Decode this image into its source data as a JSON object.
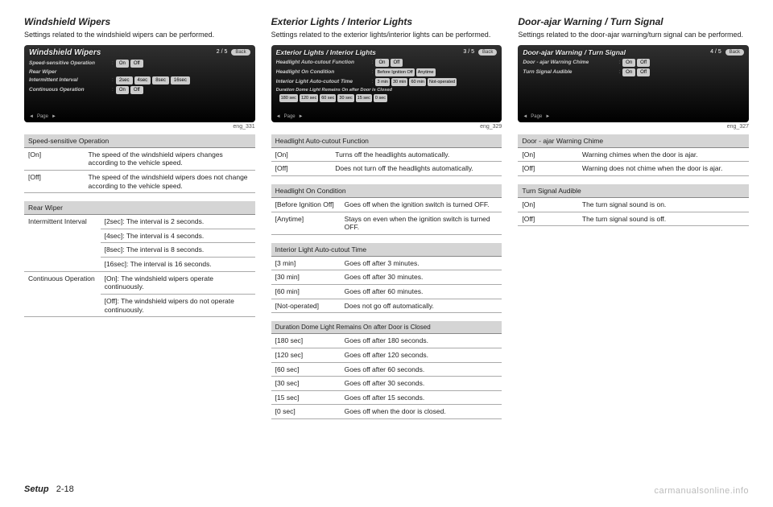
{
  "footer": {
    "label": "Setup",
    "page": "2-18"
  },
  "watermark": "carmanualsonline.info",
  "col1": {
    "heading": "Windshield Wipers",
    "intro": "Settings related to the windshield wipers can be performed.",
    "eng": "eng_331",
    "panel": {
      "title": "Windshield Wipers",
      "page": "2 / 5",
      "back": "Back",
      "rows": {
        "r1_label": "Speed-sensitive Operation",
        "r1_opts": [
          "On",
          "Off"
        ],
        "r2_label": "Rear Wiper",
        "r3_label": "Intermittent Interval",
        "r3_opts": [
          "2sec",
          "4sec",
          "8sec",
          "16sec"
        ],
        "r4_label": "Continuous Operation",
        "r4_opts": [
          "On",
          "Off"
        ]
      },
      "footer": {
        "prev": "◄",
        "label": "Page",
        "next": "►"
      }
    },
    "table1": {
      "header": "Speed-sensitive Operation",
      "rows": [
        {
          "k": "[On]",
          "v": "The speed of the windshield wipers changes according to the vehicle speed."
        },
        {
          "k": "[Off]",
          "v": "The speed of the windshield wipers does not change according to the vehicle speed."
        }
      ]
    },
    "table2": {
      "header": "Rear Wiper",
      "rows": [
        {
          "k": "Intermittent Interval",
          "v": "[2sec]: The interval is 2 seconds."
        },
        {
          "k": "",
          "v": "[4sec]: The interval is 4 seconds."
        },
        {
          "k": "",
          "v": "[8sec]: The interval is 8 seconds."
        },
        {
          "k": "",
          "v": "[16sec]: The interval is 16 seconds."
        },
        {
          "k": "Continuous Operation",
          "v": "[On]: The windshield wipers operate continuously."
        },
        {
          "k": "",
          "v": "[Off]: The windshield wipers do not operate continuously."
        }
      ]
    }
  },
  "col2": {
    "heading": "Exterior Lights / Interior Lights",
    "intro": "Settings related to the exterior lights/interior lights can be performed.",
    "eng": "eng_329",
    "panel": {
      "title": "Exterior Lights / Interior Lights",
      "page": "3 / 5",
      "back": "Back",
      "rows": {
        "r1_label": "Headlight Auto-cutout Function",
        "r1_opts": [
          "On",
          "Off"
        ],
        "r2_label": "Headlight On Condition",
        "r2_opts": [
          "Before Ignition Off",
          "Anytime"
        ],
        "r3_label": "Interior Light Auto-cutout Time",
        "r3_opts": [
          "3 min",
          "30 min",
          "60 min",
          "Not-operated"
        ],
        "r4_label": "Duration Dome Light Remains On after Door is Closed",
        "r4_opts": [
          "180 sec",
          "120 sec",
          "60 sec",
          "30 sec",
          "15 sec",
          "0 sec"
        ]
      },
      "footer": {
        "prev": "◄",
        "label": "Page",
        "next": "►"
      }
    },
    "table1": {
      "header": "Headlight Auto-cutout Function",
      "rows": [
        {
          "k": "[On]",
          "v": "Turns off the headlights automatically."
        },
        {
          "k": "[Off]",
          "v": "Does not turn off the headlights automatically."
        }
      ]
    },
    "table2": {
      "header": "Headlight On Condition",
      "rows": [
        {
          "k": "[Before Ignition Off]",
          "v": "Goes off when the ignition switch is turned OFF."
        },
        {
          "k": "[Anytime]",
          "v": "Stays on even when the ignition switch is turned OFF."
        }
      ]
    },
    "table3": {
      "header": "Interior Light Auto-cutout Time",
      "rows": [
        {
          "k": "[3 min]",
          "v": "Goes off after 3 minutes."
        },
        {
          "k": "[30 min]",
          "v": "Goes off after 30 minutes."
        },
        {
          "k": "[60 min]",
          "v": "Goes off after 60 minutes."
        },
        {
          "k": "[Not-operated]",
          "v": "Does not go off automatically."
        }
      ]
    },
    "table4": {
      "header": "Duration Dome Light Remains On after Door is Closed",
      "rows": [
        {
          "k": "[180 sec]",
          "v": "Goes off after 180 seconds."
        },
        {
          "k": "[120 sec]",
          "v": "Goes off after 120 seconds."
        },
        {
          "k": "[60 sec]",
          "v": "Goes off after 60 seconds."
        },
        {
          "k": "[30 sec]",
          "v": "Goes off after 30 seconds."
        },
        {
          "k": "[15 sec]",
          "v": "Goes off after 15 seconds."
        },
        {
          "k": "[0 sec]",
          "v": "Goes off when the door is closed."
        }
      ]
    }
  },
  "col3": {
    "heading": "Door-ajar Warning / Turn Signal",
    "intro": "Settings related to the door-ajar warning/turn signal can be performed.",
    "eng": "eng_327",
    "panel": {
      "title": "Door-ajar Warning / Turn Signal",
      "page": "4 / 5",
      "back": "Back",
      "rows": {
        "r1_label": "Door - ajar Warning Chime",
        "r1_opts": [
          "On",
          "Off"
        ],
        "r2_label": "Turn Signal Audible",
        "r2_opts": [
          "On",
          "Off"
        ]
      },
      "footer": {
        "prev": "◄",
        "label": "Page",
        "next": "►"
      }
    },
    "table1": {
      "header": "Door - ajar Warning Chime",
      "rows": [
        {
          "k": "[On]",
          "v": "Warning chimes when the door is ajar."
        },
        {
          "k": "[Off]",
          "v": "Warning does not chime when the door is ajar."
        }
      ]
    },
    "table2": {
      "header": "Turn Signal Audible",
      "rows": [
        {
          "k": "[On]",
          "v": "The turn signal sound is on."
        },
        {
          "k": "[Off]",
          "v": "The turn signal sound is off."
        }
      ]
    }
  }
}
